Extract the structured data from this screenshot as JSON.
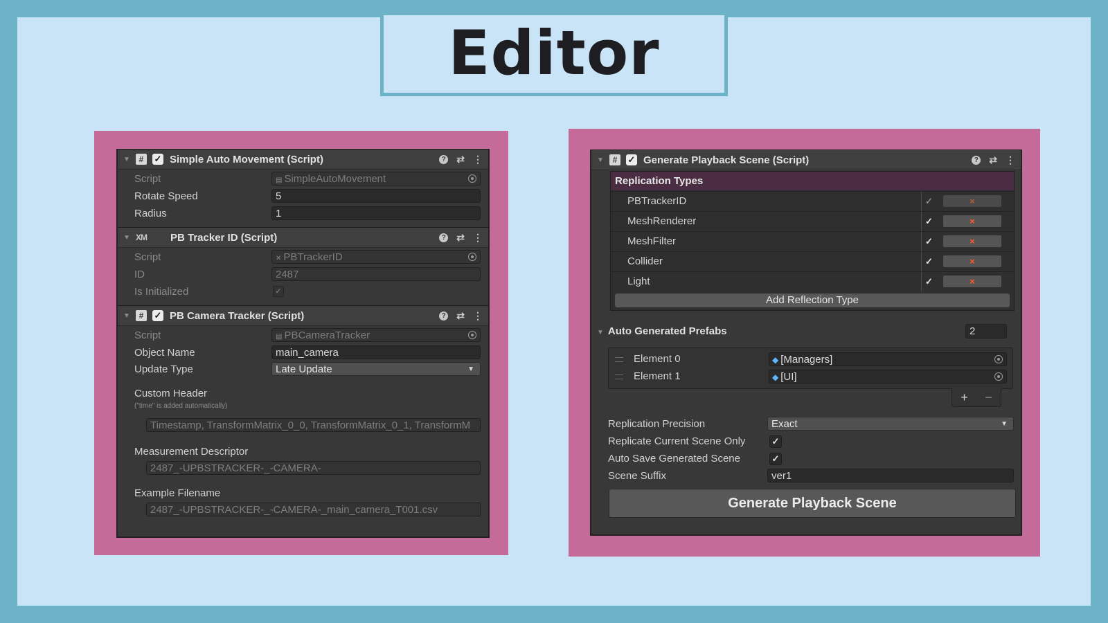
{
  "banner": {
    "title": "Editor"
  },
  "left_panel": {
    "components": [
      {
        "title": "Simple Auto Movement (Script)",
        "icon": "script-icon",
        "enabled": true,
        "fields": [
          {
            "label": "Script",
            "value": "SimpleAutoMovement"
          },
          {
            "label": "Rotate Speed",
            "value": "5"
          },
          {
            "label": "Radius",
            "value": "1"
          }
        ]
      },
      {
        "title": "PB Tracker ID (Script)",
        "icon": "xm-icon",
        "icon_text": "XM",
        "enabled": null,
        "fields": [
          {
            "label": "Script",
            "value": "PBTrackerID"
          },
          {
            "label": "ID",
            "value": "2487"
          },
          {
            "label": "Is Initialized",
            "value": "✓"
          }
        ]
      },
      {
        "title": "PB Camera Tracker (Script)",
        "icon": "script-icon",
        "enabled": true,
        "fields": [
          {
            "label": "Script",
            "value": "PBCameraTracker"
          },
          {
            "label": "Object Name",
            "value": "main_camera"
          },
          {
            "label": "Update Type",
            "value": "Late Update"
          }
        ],
        "custom_header": {
          "label": "Custom Header",
          "note": "(\"time\" is added automatically)",
          "value": "Timestamp, TransformMatrix_0_0, TransformMatrix_0_1, TransformM"
        },
        "measurement_descriptor": {
          "label": "Measurement Descriptor",
          "value": "2487_-UPBSTRACKER-_-CAMERA-"
        },
        "example_filename": {
          "label": "Example Filename",
          "value": "2487_-UPBSTRACKER-_-CAMERA-_main_camera_T001.csv"
        }
      }
    ]
  },
  "right_panel": {
    "component": {
      "title": "Generate Playback Scene (Script)",
      "enabled": true
    },
    "replication_types": {
      "title": "Replication Types",
      "items": [
        {
          "name": "PBTrackerID",
          "checked": true,
          "dim": true
        },
        {
          "name": "MeshRenderer",
          "checked": true,
          "dim": false
        },
        {
          "name": "MeshFilter",
          "checked": true,
          "dim": false
        },
        {
          "name": "Collider",
          "checked": true,
          "dim": false
        },
        {
          "name": "Light",
          "checked": true,
          "dim": false
        }
      ],
      "remove_glyph": "×",
      "add_button": "Add Reflection Type"
    },
    "auto_generated_prefabs": {
      "label": "Auto Generated Prefabs",
      "size": "2",
      "elements": [
        {
          "label": "Element 0",
          "value": "[Managers]"
        },
        {
          "label": "Element 1",
          "value": "[UI]"
        }
      ]
    },
    "settings": {
      "replication_precision": {
        "label": "Replication Precision",
        "value": "Exact"
      },
      "replicate_current_scene_only": {
        "label": "Replicate Current Scene Only",
        "checked": true
      },
      "auto_save_generated_scene": {
        "label": "Auto Save Generated Scene",
        "checked": true
      },
      "scene_suffix": {
        "label": "Scene Suffix",
        "value": "ver1"
      }
    },
    "generate_button": "Generate Playback Scene"
  },
  "colors": {
    "outer_border": "#6eb2c7",
    "background": "#c9e4f6",
    "frame": "#c56b9a",
    "panel": "#383838",
    "replication_header": "#4a2d42",
    "remove_x": "#ff5a2a"
  }
}
